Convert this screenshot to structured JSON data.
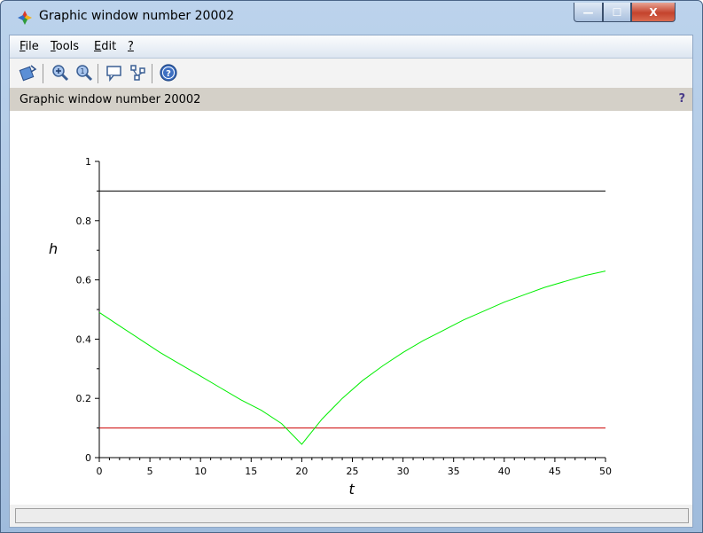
{
  "window": {
    "title": "Graphic window number 20002",
    "minimize_label": "—",
    "maximize_label": "☐",
    "close_label": "X"
  },
  "menu": {
    "items": [
      {
        "label": "File",
        "mnemonic": "F",
        "rest": "ile"
      },
      {
        "label": "Tools",
        "mnemonic": "T",
        "rest": "ools"
      },
      {
        "label": "Edit",
        "mnemonic": "E",
        "rest": "dit"
      },
      {
        "label": "?",
        "mnemonic": "?",
        "rest": ""
      }
    ]
  },
  "toolbar": {
    "icons": [
      "rotate-icon",
      "zoom-icon",
      "unzoom-icon",
      "datatip-icon",
      "editor-icon",
      "help-icon"
    ]
  },
  "infobar": {
    "text": "Graphic window number 20002",
    "help": "?"
  },
  "colors": {
    "series_black": "#000000",
    "series_green": "#00ee00",
    "series_red": "#cc0000"
  },
  "chart_data": {
    "type": "line",
    "title": "",
    "xlabel": "t",
    "ylabel": "h",
    "xlim": [
      0,
      50
    ],
    "ylim": [
      0,
      1
    ],
    "x_ticks": [
      0,
      5,
      10,
      15,
      20,
      25,
      30,
      35,
      40,
      45,
      50
    ],
    "x_tick_labels": [
      "0",
      "5",
      "10",
      "15",
      "20",
      "25",
      "30",
      "35",
      "40",
      "45",
      "50"
    ],
    "y_ticks": [
      0,
      0.2,
      0.4,
      0.6,
      0.8,
      1
    ],
    "y_tick_labels": [
      "0",
      "0.2",
      "0.4",
      "0.6",
      "0.8",
      "1"
    ],
    "grid": false,
    "series": [
      {
        "color": "#000000",
        "x": [
          0,
          50
        ],
        "y": [
          0.9,
          0.9
        ]
      },
      {
        "color": "#cc0000",
        "x": [
          0,
          50
        ],
        "y": [
          0.1,
          0.1
        ]
      },
      {
        "color": "#00ee00",
        "x": [
          0,
          2,
          4,
          6,
          8,
          10,
          12,
          14,
          16,
          18,
          20,
          22,
          24,
          26,
          28,
          30,
          32,
          34,
          36,
          38,
          40,
          42,
          44,
          46,
          48,
          50
        ],
        "y": [
          0.49,
          0.445,
          0.4,
          0.355,
          0.315,
          0.275,
          0.235,
          0.195,
          0.16,
          0.115,
          0.045,
          0.13,
          0.2,
          0.26,
          0.31,
          0.355,
          0.395,
          0.43,
          0.465,
          0.495,
          0.525,
          0.55,
          0.575,
          0.595,
          0.615,
          0.63
        ]
      }
    ]
  }
}
